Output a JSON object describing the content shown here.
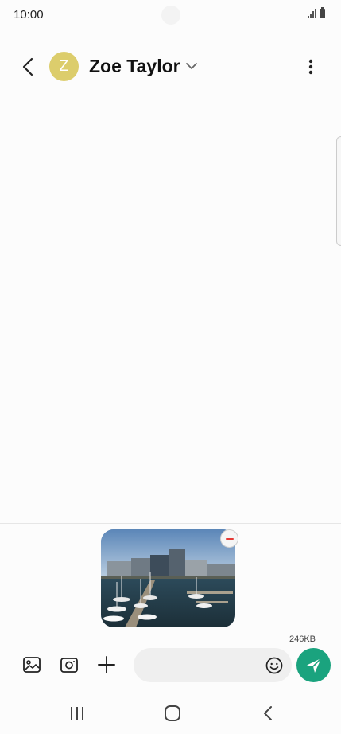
{
  "status_bar": {
    "time": "10:00"
  },
  "header": {
    "contact_initial": "Z",
    "contact_name": "Zoe Taylor",
    "avatar_color": "#dccd6c"
  },
  "attachment": {
    "size": "246KB",
    "image": "harbor-marina-photo"
  },
  "composer": {
    "message_value": "",
    "icons": [
      "gallery-icon",
      "camera-icon",
      "plus-icon",
      "emoji-icon",
      "send-icon"
    ],
    "send_color": "#1aa37e"
  },
  "nav_bar": {
    "icons": [
      "recent-apps-icon",
      "home-icon",
      "back-icon"
    ]
  }
}
